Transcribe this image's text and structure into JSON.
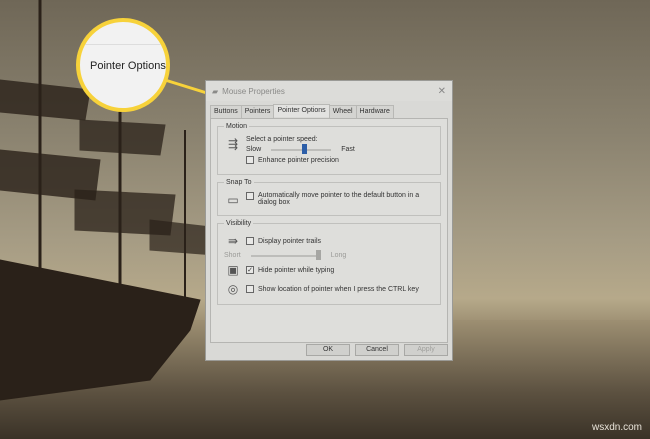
{
  "callout": {
    "label": "Pointer Options",
    "accent": "#f7d23a"
  },
  "dialog": {
    "title": "Mouse Properties",
    "close": "✕",
    "tabs": [
      "Buttons",
      "Pointers",
      "Pointer Options",
      "Wheel",
      "Hardware"
    ],
    "motion": {
      "legend": "Motion",
      "speed_label": "Select a pointer speed:",
      "slow": "Slow",
      "fast": "Fast",
      "speed_value_percent": 55,
      "enhance": "Enhance pointer precision",
      "enhance_checked": false
    },
    "snap": {
      "legend": "Snap To",
      "auto_move": "Automatically move pointer to the default button in a dialog box",
      "checked": false
    },
    "visibility": {
      "legend": "Visibility",
      "trails": "Display pointer trails",
      "trails_checked": false,
      "short": "Short",
      "long": "Long",
      "trail_value_percent": 100,
      "hide": "Hide pointer while typing",
      "hide_checked": true,
      "show_ctrl": "Show location of pointer when I press the CTRL key",
      "show_checked": false
    },
    "buttons": {
      "ok": "OK",
      "cancel": "Cancel",
      "apply": "Apply"
    }
  },
  "watermark": "wsxdn.com"
}
